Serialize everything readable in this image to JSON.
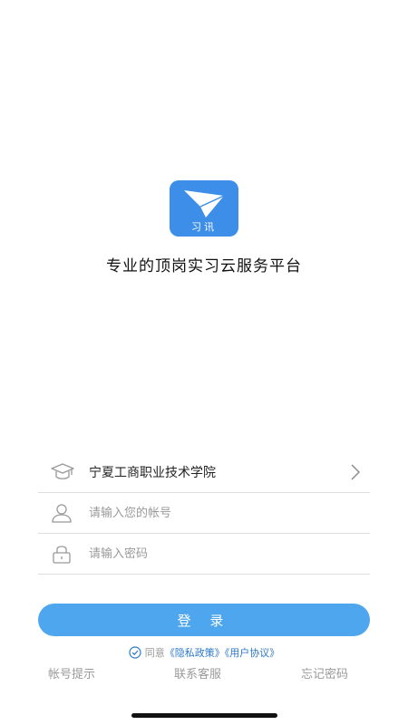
{
  "app": {
    "logo_text": "习讯",
    "slogan": "专业的顶岗实习云服务平台",
    "brand_color": "#3d8ee8"
  },
  "form": {
    "school": {
      "value": "宁夏工商职业技术学院",
      "icon": "graduation-cap-icon"
    },
    "account": {
      "placeholder": "请输入您的帐号",
      "value": "",
      "icon": "user-icon"
    },
    "password": {
      "placeholder": "请输入密码",
      "value": "",
      "icon": "lock-icon"
    }
  },
  "login_button": {
    "label": "登 录",
    "color": "#4ea6ee"
  },
  "agreement": {
    "prefix": "同意",
    "privacy_policy": "《隐私政策》",
    "user_agreement": "《用户协议》",
    "checked": true
  },
  "bottom_links": {
    "account_hint": "帐号提示",
    "contact_support": "联系客服",
    "forgot_password": "忘记密码"
  }
}
